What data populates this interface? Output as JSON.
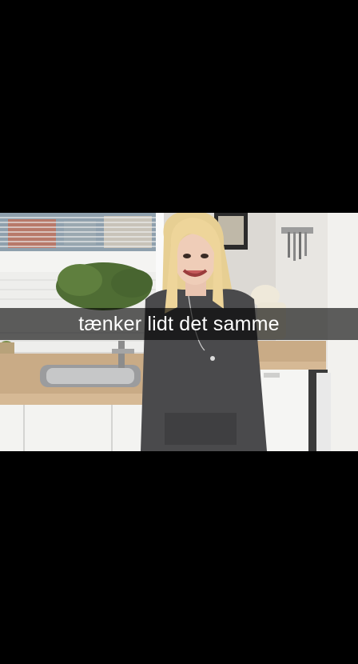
{
  "caption": {
    "text": "tænker lidt det samme"
  },
  "photo": {
    "description_icon": "photo-snapshot"
  },
  "colors": {
    "background": "#000000",
    "caption_bar": "rgba(0,0,0,0.62)",
    "caption_text": "#ffffff"
  }
}
